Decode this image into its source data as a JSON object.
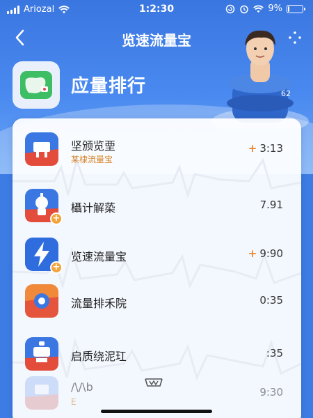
{
  "status_bar": {
    "carrier": "Ariozal",
    "time": "1:2:30",
    "battery": "9%",
    "battery_level": 0.09
  },
  "nav": {
    "title": "览速流量宝"
  },
  "header": {
    "title": "应量排行",
    "avatar_badge": "62"
  },
  "colors": {
    "primary": "#3a76e0",
    "accent_orange": "#e8862a",
    "row_subtitle": "#d7862c"
  },
  "list": {
    "items": [
      {
        "name": "坚颁览垔",
        "subtitle": "某棣流量宝",
        "value": "3:13",
        "plus": "+",
        "icon": "red-blue-app-icon",
        "badge": ""
      },
      {
        "name": "欇计解蒅",
        "subtitle": "",
        "value": "7.91",
        "plus": "",
        "icon": "robot-app-icon",
        "badge": "+"
      },
      {
        "name": "览速流量宝",
        "subtitle": "",
        "value": "9:90",
        "plus": "+",
        "icon": "lightning-app-icon",
        "badge": "+"
      },
      {
        "name": "流量排禾院",
        "subtitle": "",
        "value": "0:35",
        "plus": "",
        "icon": "orange-gear-app-icon",
        "badge": ""
      },
      {
        "name": "启质绕泥玒",
        "subtitle": "",
        "value": ":35",
        "plus": "",
        "icon": "robot-red-app-icon",
        "badge": ""
      },
      {
        "name": "/\\/\\b",
        "subtitle": "E",
        "value": "9:30",
        "plus": "",
        "icon": "faded-app-icon",
        "badge": ""
      }
    ]
  }
}
